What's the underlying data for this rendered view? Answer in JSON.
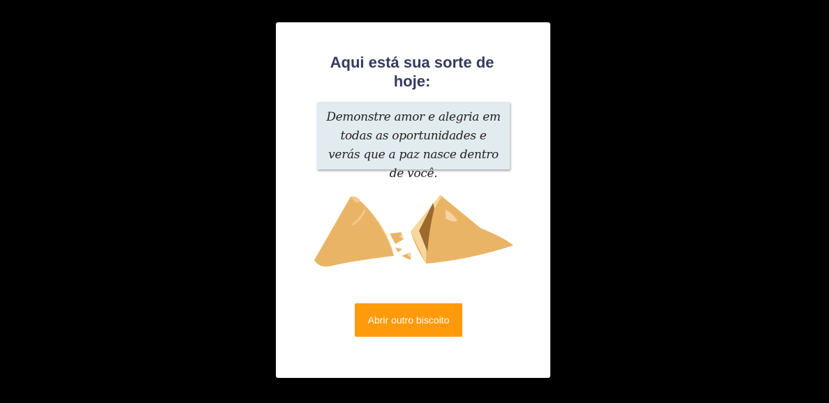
{
  "card": {
    "title": "Aqui está sua sorte de hoje:",
    "fortune_text": "Demonstre amor e alegria em todas as oportunidades e verás que a paz nasce dentro de você.",
    "cookie_icon": "broken-fortune-cookie",
    "button_label": "Abrir outro biscoito"
  },
  "colors": {
    "background": "#000000",
    "card": "#ffffff",
    "title": "#343a5e",
    "fortune_paper": "#e2ebf0",
    "button": "#ff9b0a",
    "cookie": "#eab466"
  }
}
